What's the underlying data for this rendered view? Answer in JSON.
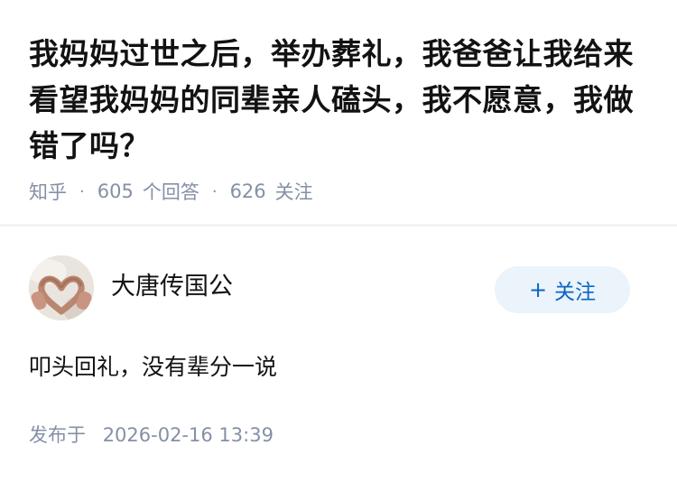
{
  "question": {
    "title": "我妈妈过世之后，举办葬礼，我爸爸让我给来看望我妈妈的同辈亲人磕头，我不愿意，我做错了吗？",
    "source": "知乎",
    "answer_count": "605",
    "answer_label": "个回答",
    "follower_count": "626",
    "follower_label": "关注",
    "separator": "·"
  },
  "answer": {
    "author_name": "大唐传国公",
    "avatar_icon": "avatar-hands-heart",
    "follow_plus": "+",
    "follow_label": "关注",
    "content": "叩头回礼，没有辈分一说",
    "publish_label": "发布于",
    "publish_time": "2026-02-16 13:39"
  },
  "colors": {
    "title": "#121212",
    "meta": "#8590a6",
    "follow_bg": "#ebf3fb",
    "follow_text": "#0a66c2",
    "divider": "#f3f3f3"
  }
}
